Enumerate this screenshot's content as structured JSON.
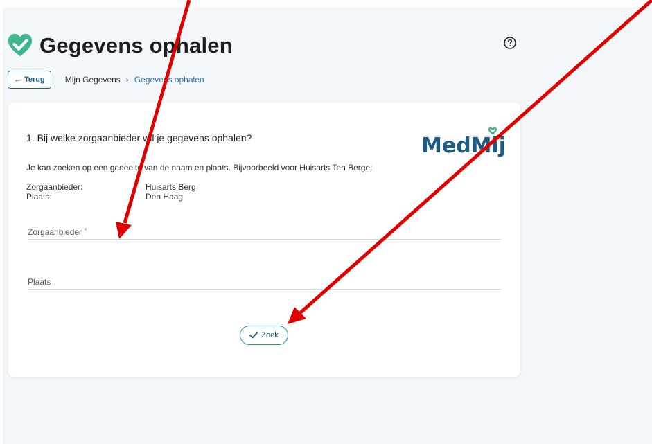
{
  "header": {
    "title": "Gegevens ophalen",
    "icon": "heart-check-icon",
    "help_icon": "question-circle-icon"
  },
  "nav": {
    "back_label": "Terug",
    "breadcrumb": [
      "Mijn Gegevens",
      "Gegevens ophalen"
    ]
  },
  "card": {
    "question": "1. Bij welke zorgaanbieder wil je gegevens ophalen?",
    "logo_text": "MedMij",
    "hint": "Je kan zoeken op een gedeelte van de naam en plaats. Bijvoorbeeld voor Huisarts Ten Berge:",
    "example": [
      {
        "key": "Zorgaanbieder:",
        "value": "Huisarts Berg"
      },
      {
        "key": "Plaats:",
        "value": "Den Haag"
      }
    ],
    "fields": {
      "provider": {
        "label": "Zorgaanbieder",
        "required_marker": "*",
        "value": ""
      },
      "place": {
        "label": "Plaats",
        "value": ""
      }
    },
    "search_label": "Zoek"
  },
  "colors": {
    "accent": "#1b5b84",
    "brand_green": "#3fb68e",
    "link": "#2a6db5",
    "annotation": "#e00000"
  }
}
